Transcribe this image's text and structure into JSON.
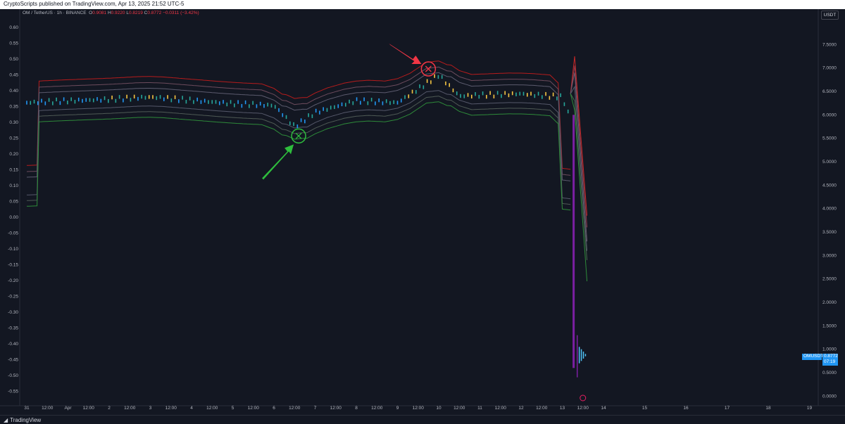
{
  "header": {
    "publisher": "CryptoScripts published on TradingView.com, Apr 13, 2025 21:52 UTC-5"
  },
  "legend": {
    "symbol": "OM / TetherUS · 1h · BINANCE",
    "o_label": "O",
    "o_value": "0.9081",
    "h_label": "H",
    "h_value": "0.9220",
    "l_label": "L",
    "l_value": "0.8219",
    "c_label": "C",
    "c_value": "0.8772",
    "change": "−0.0311 (−3.42%)"
  },
  "toolbar": {
    "currency": "USDT"
  },
  "price_tag": {
    "symbol": "OMUSDT",
    "price": "0.8772",
    "countdown": "07:19"
  },
  "footer": {
    "brand": "TradingView"
  },
  "colors": {
    "background": "#131722",
    "bull": "#26a69a",
    "bear_sell_marker": "#f23645",
    "buy_marker": "#2ebd3d",
    "crash_purple": "#7b1fa2"
  },
  "chart_data": {
    "type": "line",
    "left_axis": {
      "ticks": [
        "0.60",
        "0.55",
        "0.50",
        "0.45",
        "0.40",
        "0.35",
        "0.30",
        "0.25",
        "0.20",
        "0.15",
        "0.10",
        "0.05",
        "0.00",
        "-0.05",
        "-0.10",
        "-0.15",
        "-0.20",
        "-0.25",
        "-0.30",
        "-0.35",
        "-0.40",
        "-0.45",
        "-0.50",
        "-0.55"
      ],
      "range": [
        -0.58,
        0.62
      ]
    },
    "right_axis": {
      "ticks": [
        "7.5000",
        "7.0000",
        "6.5000",
        "6.0000",
        "5.5000",
        "5.0000",
        "4.5000",
        "4.0000",
        "3.5000",
        "3.0000",
        "2.5000",
        "2.0000",
        "1.5000",
        "1.0000",
        "0.5000",
        "0.0000"
      ],
      "range": [
        -0.1,
        8.0
      ]
    },
    "x_axis": {
      "ticks": [
        "31",
        "12:00",
        "Apr",
        "12:00",
        "2",
        "12:00",
        "3",
        "12:00",
        "4",
        "12:00",
        "5",
        "12:00",
        "6",
        "12:00",
        "7",
        "12:00",
        "8",
        "12:00",
        "9",
        "12:00",
        "10",
        "12:00",
        "11",
        "12:00",
        "12",
        "12:00",
        "13",
        "12:00",
        "14",
        "15",
        "16",
        "17",
        "18",
        "19"
      ]
    },
    "price_series": [
      {
        "day": 0,
        "p": 6.26
      },
      {
        "day": 1,
        "p": 6.3
      },
      {
        "day": 2,
        "p": 6.33
      },
      {
        "day": 3,
        "p": 6.38
      },
      {
        "day": 4,
        "p": 6.31
      },
      {
        "day": 5,
        "p": 6.24
      },
      {
        "day": 6.0,
        "p": 6.2
      },
      {
        "day": 6.5,
        "p": 5.75
      },
      {
        "day": 7,
        "p": 6.05
      },
      {
        "day": 8,
        "p": 6.3
      },
      {
        "day": 9,
        "p": 6.26
      },
      {
        "day": 9.5,
        "p": 6.55
      },
      {
        "day": 10,
        "p": 6.85
      },
      {
        "day": 10.5,
        "p": 6.4
      },
      {
        "day": 11,
        "p": 6.42
      },
      {
        "day": 12,
        "p": 6.45
      },
      {
        "day": 13,
        "p": 6.38
      },
      {
        "day": 13.2,
        "p": 5.9
      },
      {
        "day": 13.3,
        "p": 0.45
      },
      {
        "day": 13.5,
        "p": 0.88
      }
    ],
    "markers": [
      {
        "type": "buy",
        "day": 6.6,
        "p": 5.55
      },
      {
        "type": "sell",
        "day": 9.75,
        "p": 6.98
      }
    ]
  }
}
